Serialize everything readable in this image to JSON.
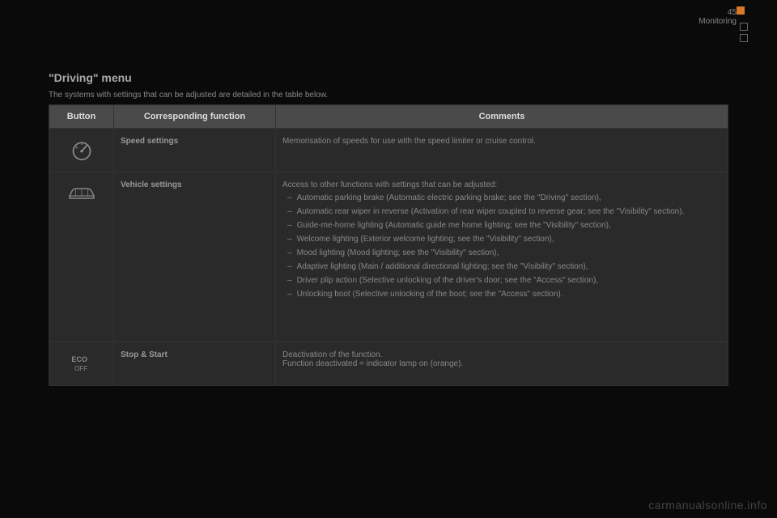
{
  "header": {
    "page_number": "45",
    "section": "Monitoring"
  },
  "title": "\"Driving\" menu",
  "intro": "The systems with settings that can be adjusted are detailed in the table below.",
  "table": {
    "headers": {
      "button": "Button",
      "function": "Corresponding function",
      "comments": "Comments"
    },
    "rows": [
      {
        "icon": "speedometer-icon",
        "function": "Speed settings",
        "comments_text": "Memorisation of speeds for use with the speed limiter or cruise control."
      },
      {
        "icon": "car-icon",
        "function": "Vehicle settings",
        "comments_intro": "Access to other functions with settings that can be adjusted:",
        "items": [
          "Automatic parking brake (Automatic electric parking brake; see the \"Driving\" section),",
          "Automatic rear wiper in reverse (Activation of rear wiper coupled to reverse gear; see the \"Visibility\" section),",
          "Guide-me-home lighting (Automatic guide me home lighting; see the \"Visibility\" section),",
          "Welcome lighting (Exterior welcome lighting; see the \"Visibility\" section),",
          "Mood lighting (Mood lighting; see the \"Visibility\" section),",
          "Adaptive lighting (Main / additional directional lighting; see the \"Visibility\" section),",
          "Driver plip action (Selective unlocking of the driver's door; see the \"Access\" section),",
          "Unlocking boot (Selective unlocking of the boot; see the \"Access\" section)."
        ]
      },
      {
        "icon": "eco-off-icon",
        "function": "Stop & Start",
        "comments_line1": "Deactivation of the function.",
        "comments_line2": "Function deactivated = indicator lamp on (orange)."
      }
    ]
  },
  "watermark": "carmanualsonline.info"
}
